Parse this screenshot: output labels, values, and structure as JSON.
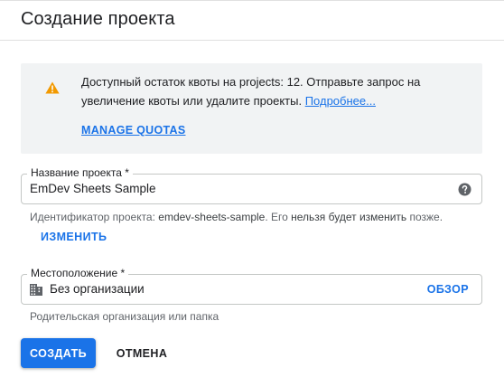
{
  "header": {
    "title": "Создание проекта"
  },
  "quota": {
    "icon": "warning-icon",
    "message": "Доступный остаток квоты на projects: 12. Отправьте запрос на увеличение квоты или удалите проекты.",
    "learn_more": "Подробнее...",
    "manage_label": "MANAGE QUOTAS",
    "icon_color": "#f29900"
  },
  "project_name": {
    "label": "Название проекта *",
    "value": "EmDev Sheets Sample",
    "help_icon": "help-icon"
  },
  "project_id_hint": {
    "prefix": "Идентификатор проекта: ",
    "id": "emdev-sheets-sample",
    "middle": ". Его ",
    "emphasis": "нельзя будет изменить",
    "suffix": " позже."
  },
  "change_label": "ИЗМЕНИТЬ",
  "location": {
    "label": "Местоположение *",
    "icon": "building-icon",
    "value": "Без организации",
    "browse_label": "ОБЗОР",
    "hint": "Родительская организация или папка"
  },
  "actions": {
    "create_label": "СОЗДАТЬ",
    "cancel_label": "ОТМЕНА"
  },
  "colors": {
    "accent": "#1a73e8",
    "panel": "#f1f3f4"
  }
}
